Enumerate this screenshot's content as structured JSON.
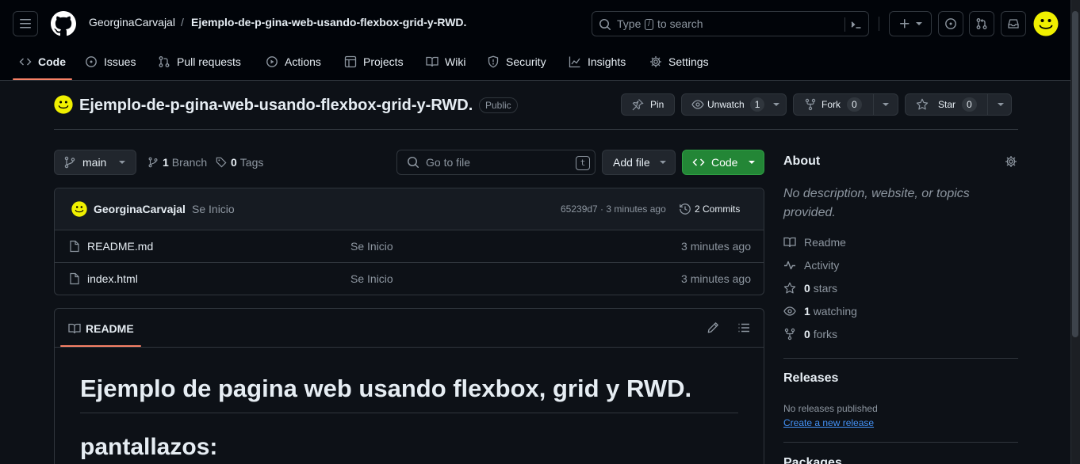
{
  "header": {
    "owner": "GeorginaCarvajal",
    "separator": "/",
    "repo": "Ejemplo-de-p-gina-web-usando-flexbox-grid-y-RWD.",
    "search_pre": "Type",
    "search_key": "/",
    "search_post": "to search"
  },
  "nav": [
    {
      "label": "Code",
      "icon": "code-icon"
    },
    {
      "label": "Issues",
      "icon": "issue-icon"
    },
    {
      "label": "Pull requests",
      "icon": "pull-request-icon"
    },
    {
      "label": "Actions",
      "icon": "play-icon"
    },
    {
      "label": "Projects",
      "icon": "table-icon"
    },
    {
      "label": "Wiki",
      "icon": "book-icon"
    },
    {
      "label": "Security",
      "icon": "shield-icon"
    },
    {
      "label": "Insights",
      "icon": "graph-icon"
    },
    {
      "label": "Settings",
      "icon": "gear-icon"
    }
  ],
  "repo": {
    "title": "Ejemplo-de-p-gina-web-usando-flexbox-grid-y-RWD.",
    "visibility": "Public",
    "pin": "Pin",
    "unwatch": "Unwatch",
    "watch_count": "1",
    "fork": "Fork",
    "fork_count": "0",
    "star": "Star",
    "star_count": "0"
  },
  "toolbar": {
    "branch": "main",
    "branch_count": "1",
    "branch_label": "Branch",
    "tag_count": "0",
    "tag_label": "Tags",
    "goto_placeholder": "Go to file",
    "goto_key": "t",
    "add_file": "Add file",
    "code": "Code"
  },
  "commit": {
    "author": "GeorginaCarvajal",
    "message": "Se Inicio",
    "hash_time": "65239d7 · 3 minutes ago",
    "commits": "2 Commits"
  },
  "files": [
    {
      "name": "README.md",
      "message": "Se Inicio",
      "time": "3 minutes ago"
    },
    {
      "name": "index.html",
      "message": "Se Inicio",
      "time": "3 minutes ago"
    }
  ],
  "readme": {
    "tab": "README",
    "h1": "Ejemplo de pagina web usando flexbox, grid y RWD.",
    "h2": "pantallazos:"
  },
  "about": {
    "title": "About",
    "description": "No description, website, or topics provided.",
    "readme": "Readme",
    "activity": "Activity",
    "stars_count": "0",
    "stars_label": "stars",
    "watching_count": "1",
    "watching_label": "watching",
    "forks_count": "0",
    "forks_label": "forks"
  },
  "releases": {
    "title": "Releases",
    "none": "No releases published",
    "create": "Create a new release"
  },
  "packages": {
    "title": "Packages"
  },
  "colors": {
    "accent": "#f78166",
    "green": "#238636",
    "link": "#4493f8",
    "bg": "#0d1117"
  }
}
